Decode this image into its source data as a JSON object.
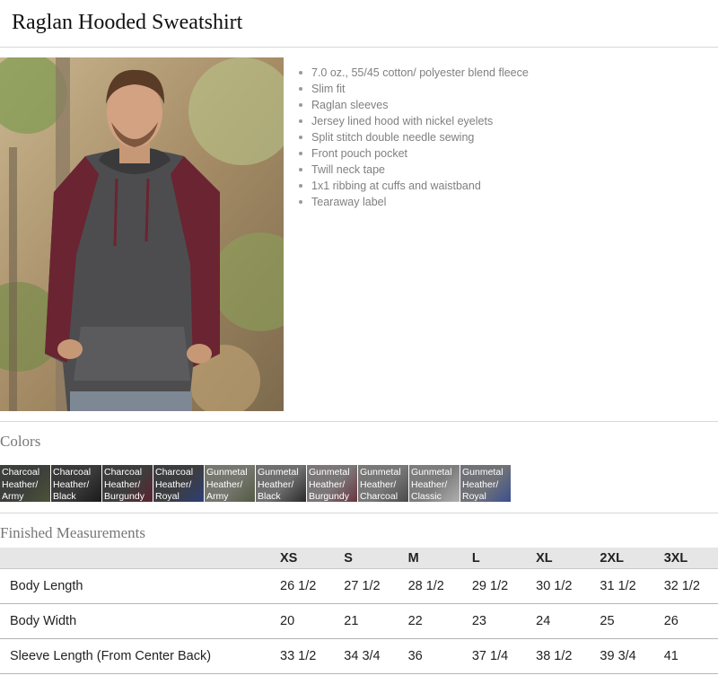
{
  "page": {
    "title": "Raglan Hooded Sweatshirt"
  },
  "features": [
    "7.0 oz.,  55/45 cotton/ polyester blend fleece",
    "Slim fit",
    "Raglan sleeves",
    "Jersey lined hood with nickel eyelets",
    "Split stitch double needle sewing",
    "Front pouch pocket",
    "Twill neck tape",
    "1x1 ribbing at cuffs and waistband",
    "Tearaway label"
  ],
  "colors": {
    "heading": "Colors",
    "swatches": [
      {
        "name": "Charcoal\nHeather/\nArmy",
        "bg": "#3d3f3c",
        "accent": "#4b5437"
      },
      {
        "name": "Charcoal\nHeather/\nBlack",
        "bg": "#3a3a3a",
        "accent": "#1a1a1a"
      },
      {
        "name": "Charcoal\nHeather/\nBurgundy",
        "bg": "#3e3d3d",
        "accent": "#5a2330"
      },
      {
        "name": "Charcoal\nHeather/\nRoyal",
        "bg": "#3c3d40",
        "accent": "#2c3f77"
      },
      {
        "name": "Gunmetal\nHeather/\nArmy",
        "bg": "#76776f",
        "accent": "#545a43"
      },
      {
        "name": "Gunmetal\nHeather/\nBlack",
        "bg": "#6f6f6f",
        "accent": "#2a2a2a"
      },
      {
        "name": "Gunmetal\nHeather/\nBurgundy",
        "bg": "#7b7677",
        "accent": "#6b3440"
      },
      {
        "name": "Gunmetal\nHeather/\nCharcoal",
        "bg": "#787878",
        "accent": "#4a4a4a"
      },
      {
        "name": "Gunmetal\nHeather/\nClassic",
        "bg": "#7d7d7d",
        "accent": "#b0b0b0"
      },
      {
        "name": "Gunmetal\nHeather/\nRoyal",
        "bg": "#707278",
        "accent": "#3a4f8f"
      }
    ]
  },
  "measurements": {
    "heading": "Finished Measurements",
    "sizes": [
      "XS",
      "S",
      "M",
      "L",
      "XL",
      "2XL",
      "3XL"
    ],
    "rows": [
      {
        "label": "Body Length",
        "values": [
          "26 1/2",
          "27 1/2",
          "28 1/2",
          "29 1/2",
          "30 1/2",
          "31 1/2",
          "32 1/2"
        ]
      },
      {
        "label": "Body Width",
        "values": [
          "20",
          "21",
          "22",
          "23",
          "24",
          "25",
          "26"
        ]
      },
      {
        "label": "Sleeve Length (From Center Back)",
        "values": [
          "33 1/2",
          "34 3/4",
          "36",
          "37 1/4",
          "38 1/2",
          "39 3/4",
          "41"
        ]
      }
    ]
  }
}
